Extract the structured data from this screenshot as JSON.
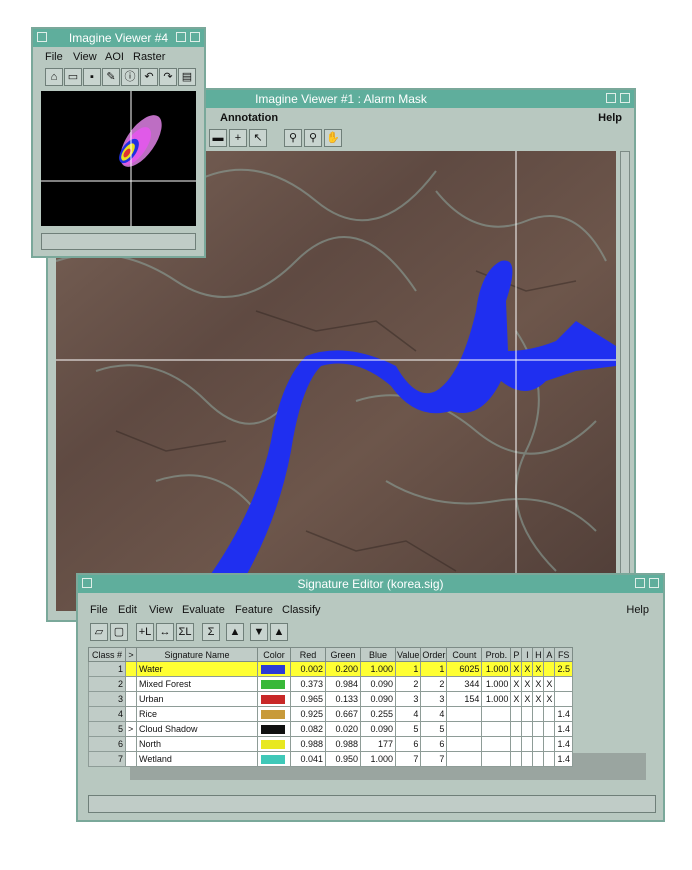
{
  "viewer1": {
    "title": "Imagine Viewer #1 : Alarm Mask",
    "menu": [
      "Annotation",
      "Help"
    ]
  },
  "viewer4": {
    "title": "Imagine Viewer #4",
    "menu": [
      "File",
      "View",
      "AOI",
      "Raster"
    ]
  },
  "sig_editor": {
    "title": "Signature Editor (korea.sig)",
    "menu": [
      "File",
      "Edit",
      "View",
      "Evaluate",
      "Feature",
      "Classify",
      "Help"
    ],
    "columns": [
      "Class #",
      ">",
      "Signature Name",
      "Color",
      "Red",
      "Green",
      "Blue",
      "Value",
      "Order",
      "Count",
      "Prob.",
      "P",
      "I",
      "H",
      "A",
      "FS"
    ],
    "rows": [
      {
        "cls": "1",
        "mark": "",
        "name": "Water",
        "color": "#2d3bd6",
        "red": "0.002",
        "green": "0.200",
        "blue": "1.000",
        "value": "1",
        "order": "1",
        "count": "6025",
        "prob": "1.000",
        "p": "X",
        "i": "X",
        "h": "X",
        "a": "",
        "fs": "2.5",
        "selected": true
      },
      {
        "cls": "2",
        "mark": "",
        "name": "Mixed Forest",
        "color": "#38b838",
        "red": "0.373",
        "green": "0.984",
        "blue": "0.090",
        "value": "2",
        "order": "2",
        "count": "344",
        "prob": "1.000",
        "p": "X",
        "i": "X",
        "h": "X",
        "a": "X",
        "fs": "",
        "selected": false
      },
      {
        "cls": "3",
        "mark": "",
        "name": "Urban",
        "color": "#c82828",
        "red": "0.965",
        "green": "0.133",
        "blue": "0.090",
        "value": "3",
        "order": "3",
        "count": "154",
        "prob": "1.000",
        "p": "X",
        "i": "X",
        "h": "X",
        "a": "X",
        "fs": "",
        "selected": false
      },
      {
        "cls": "4",
        "mark": "",
        "name": "Rice",
        "color": "#c89a3a",
        "red": "0.925",
        "green": "0.667",
        "blue": "0.255",
        "value": "4",
        "order": "4",
        "count": "",
        "prob": "",
        "p": "",
        "i": "",
        "h": "",
        "a": "",
        "fs": "1.4",
        "selected": false
      },
      {
        "cls": "5",
        "mark": ">",
        "name": "Cloud Shadow",
        "color": "#101010",
        "red": "0.082",
        "green": "0.020",
        "blue": "0.090",
        "value": "5",
        "order": "5",
        "count": "",
        "prob": "",
        "p": "",
        "i": "",
        "h": "",
        "a": "",
        "fs": "1.4",
        "selected": false
      },
      {
        "cls": "6",
        "mark": "",
        "name": "North",
        "color": "#e8e820",
        "red": "0.988",
        "green": "0.988",
        "blue": "177",
        "value": "6",
        "order": "6",
        "count": "",
        "prob": "",
        "p": "",
        "i": "",
        "h": "",
        "a": "",
        "fs": "1.4",
        "selected": false
      },
      {
        "cls": "7",
        "mark": "",
        "name": "Wetland",
        "color": "#3fc8b8",
        "red": "0.041",
        "green": "0.950",
        "blue": "1.000",
        "value": "7",
        "order": "7",
        "count": "",
        "prob": "",
        "p": "",
        "i": "",
        "h": "",
        "a": "",
        "fs": "1.4",
        "selected": false
      }
    ]
  }
}
